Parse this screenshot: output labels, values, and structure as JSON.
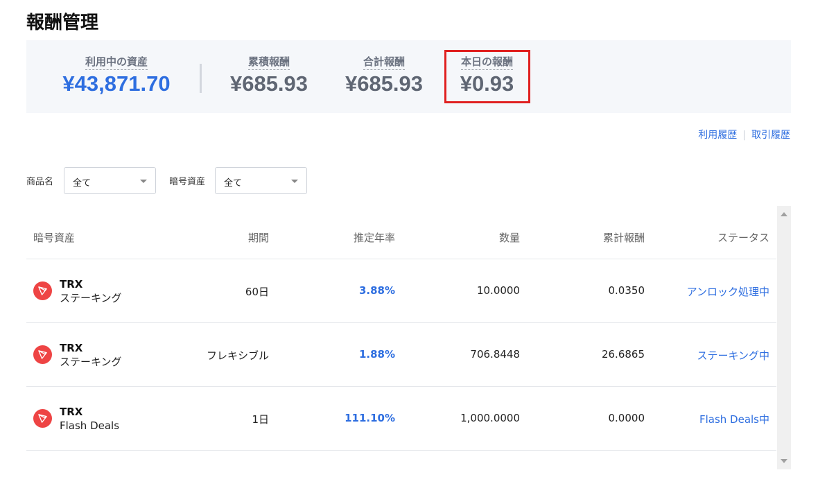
{
  "page": {
    "title": "報酬管理"
  },
  "summary": {
    "using_assets": {
      "label": "利用中の資産",
      "value": "¥43,871.70"
    },
    "cumulative_reward": {
      "label": "累積報酬",
      "value": "¥685.93"
    },
    "total_reward": {
      "label": "合計報酬",
      "value": "¥685.93"
    },
    "today_reward": {
      "label": "本日の報酬",
      "value": "¥0.93"
    }
  },
  "links": {
    "usage_history": "利用履歴",
    "trade_history": "取引履歴"
  },
  "filters": {
    "product": {
      "label": "商品名",
      "value": "全て"
    },
    "asset": {
      "label": "暗号資産",
      "value": "全て"
    }
  },
  "table": {
    "headers": [
      "暗号資産",
      "期間",
      "推定年率",
      "数量",
      "累計報酬",
      "ステータス"
    ],
    "rows": [
      {
        "symbol": "TRX",
        "product": "ステーキング",
        "period": "60日",
        "apr": "3.88%",
        "amount": "10.0000",
        "reward": "0.0350",
        "status": "アンロック処理中"
      },
      {
        "symbol": "TRX",
        "product": "ステーキング",
        "period": "フレキシブル",
        "apr": "1.88%",
        "amount": "706.8448",
        "reward": "26.6865",
        "status": "ステーキング中"
      },
      {
        "symbol": "TRX",
        "product": "Flash Deals",
        "period": "1日",
        "apr": "111.10%",
        "amount": "1,000.0000",
        "reward": "0.0000",
        "status": "Flash Deals中"
      }
    ]
  },
  "icons": {
    "coin": "tron-icon",
    "accent_color": "#2e6ee0",
    "highlight_color": "#e02020",
    "coin_color": "#ee4444"
  }
}
